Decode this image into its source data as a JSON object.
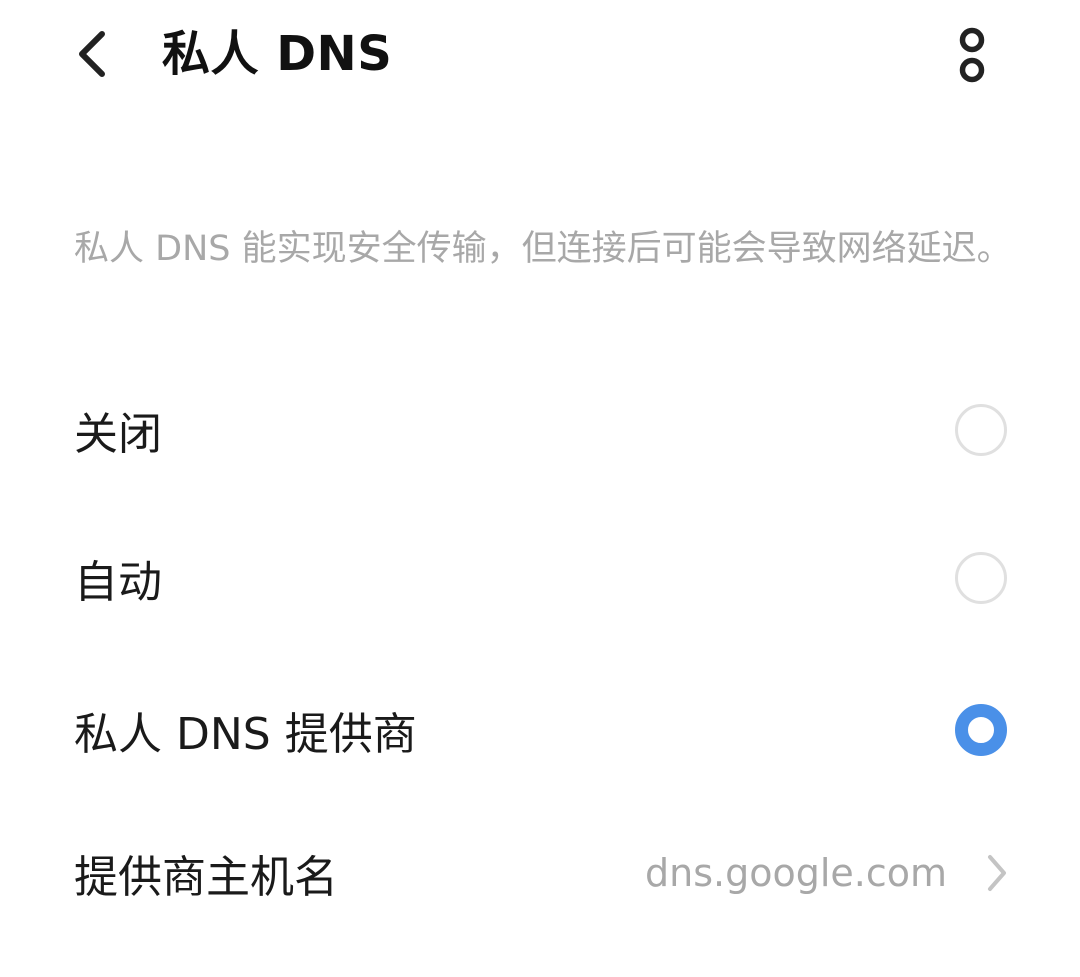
{
  "header": {
    "title": "私人 DNS",
    "back_icon": "chevron-left-icon",
    "more_icon": "more-vertical-icon"
  },
  "description": "私人 DNS 能实现安全传输，但连接后可能会导致网络延迟。",
  "options": [
    {
      "label": "关闭",
      "selected": false
    },
    {
      "label": "自动",
      "selected": false
    },
    {
      "label": "私人 DNS 提供商",
      "selected": true
    }
  ],
  "hostname": {
    "label": "提供商主机名",
    "value": "dns.google.com",
    "icon": "chevron-right-icon"
  },
  "colors": {
    "accent": "#4a90e8",
    "secondary_text": "#a8a8a8",
    "radio_border": "#e0e0e0"
  }
}
